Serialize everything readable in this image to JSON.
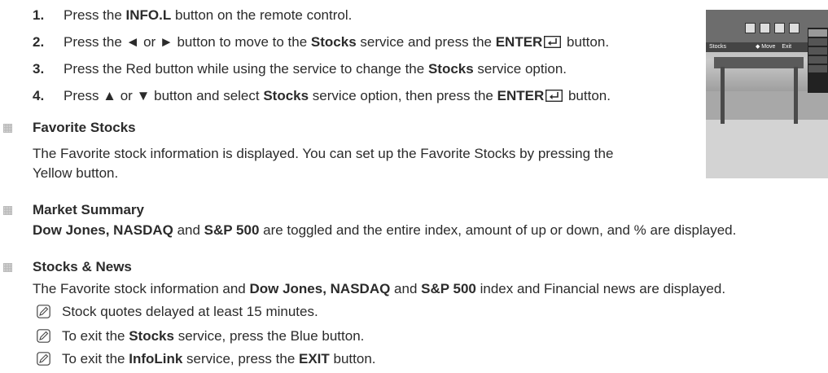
{
  "steps": [
    {
      "num": "1.",
      "t1": "Press the ",
      "b1": "INFO.L",
      "t2": " button on the remote control."
    },
    {
      "num": "2.",
      "t1": "Press the ◄ or ► button to move to the ",
      "b1": "Stocks",
      "t2": " service and press the ",
      "b2": "ENTER",
      "t3": " button."
    },
    {
      "num": "3.",
      "t1": "Press the Red button while using the service to change the ",
      "b1": "Stocks",
      "t2": " service option."
    },
    {
      "num": "4.",
      "t1": "Press ▲ or ▼ button and select ",
      "b1": "Stocks",
      "t2": " service option, then press the ",
      "b2": "ENTER",
      "t3": " button."
    }
  ],
  "sections": {
    "favorite": {
      "heading": "Favorite Stocks",
      "line1": "The Favorite stock information is displayed. You can set up the Favorite Stocks by pressing the",
      "line2": "Yellow button."
    },
    "market": {
      "heading": "Market Summary",
      "b1": "Dow Jones, NASDAQ",
      "t1": " and ",
      "b2": "S&P 500",
      "t2": " are toggled and the entire index, amount of up or down, and % are displayed."
    },
    "news": {
      "heading": "Stocks & News",
      "t1": "The Favorite stock information and ",
      "b1": "Dow Jones, NASDAQ",
      "t2": " and ",
      "b2": "S&P 500",
      "t3": " index and Financial news are displayed."
    }
  },
  "notes": [
    {
      "t1": "Stock quotes delayed at least 15 minutes."
    },
    {
      "t1": "To exit the ",
      "b1": "Stocks",
      "t2": " service, press the Blue button."
    },
    {
      "t1": "To exit the ",
      "b1": "InfoLink",
      "t2": " service, press the ",
      "b2": "EXIT",
      "t3": " button."
    }
  ],
  "screenshot": {
    "service_label": "Stocks",
    "move_hint": "◆ Move",
    "exit_hint": "Exit"
  },
  "icons": {
    "bullet": "square-bullet-icon",
    "note": "pencil-note-icon",
    "enter": "enter-key-icon"
  }
}
